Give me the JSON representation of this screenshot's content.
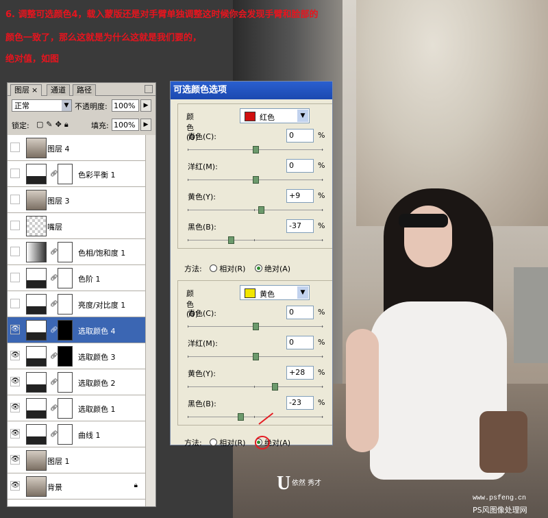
{
  "header": {
    "line1": "6. 调整可选颜色4，载入蒙版还是对手臂单独调整这时候你会发现手臂和脸部的",
    "line2": "颜色一致了，那么这就是为什么这就是我们要的，",
    "line3": "绝对值，如图"
  },
  "layers_panel": {
    "tabs": [
      {
        "label": "图层"
      },
      {
        "label": "通道"
      },
      {
        "label": "路径"
      }
    ],
    "tab_close": "×",
    "blend_mode": "正常",
    "opacity_label": "不透明度:",
    "opacity_value": "100%",
    "lock_label": "锁定:",
    "fill_label": "填充:",
    "fill_value": "100%",
    "layers": [
      {
        "name": "图层 4",
        "type": "photo",
        "visible": false
      },
      {
        "name": "色彩平衡 1",
        "type": "adjustment",
        "visible": false
      },
      {
        "name": "图层 3",
        "type": "photo",
        "visible": false
      },
      {
        "name": "嘴层",
        "type": "transparent",
        "visible": false
      },
      {
        "name": "色相/饱和度 1",
        "type": "adjustment",
        "visible": false
      },
      {
        "name": "色阶 1",
        "type": "adjustment",
        "visible": false
      },
      {
        "name": "亮度/对比度 1",
        "type": "adjustment",
        "visible": false
      },
      {
        "name": "选取颜色 4",
        "type": "adjustment",
        "visible": true,
        "selected": true,
        "mask": "black"
      },
      {
        "name": "选取颜色 3",
        "type": "adjustment",
        "visible": true,
        "mask": "black"
      },
      {
        "name": "选取颜色 2",
        "type": "adjustment",
        "visible": true
      },
      {
        "name": "选取颜色 1",
        "type": "adjustment",
        "visible": true
      },
      {
        "name": "曲线 1",
        "type": "adjustment",
        "visible": true
      },
      {
        "name": "图层 1",
        "type": "photo",
        "visible": true
      },
      {
        "name": "背景",
        "type": "photo",
        "visible": true,
        "locked": true
      }
    ]
  },
  "dialog": {
    "title": "可选颜色选项",
    "color_label": "颜色(O):",
    "percent_sign": "%",
    "method_label": "方法:",
    "relative_label": "相对(R)",
    "absolute_label": "绝对(A)",
    "group1": {
      "color": "红色",
      "swatch": "#d01010",
      "cyan_label": "青色(C):",
      "cyan": "0",
      "cyan_pos": 0.5,
      "magenta_label": "洋红(M):",
      "magenta": "0",
      "magenta_pos": 0.5,
      "yellow_label": "黄色(Y):",
      "yellow": "+9",
      "yellow_pos": 0.54,
      "black_label": "黑色(B):",
      "black": "-37",
      "black_pos": 0.32,
      "method": "absolute"
    },
    "group2": {
      "color": "黄色",
      "swatch": "#f2e600",
      "cyan_label": "青色(C):",
      "cyan": "0",
      "cyan_pos": 0.5,
      "magenta_label": "洋红(M):",
      "magenta": "0",
      "magenta_pos": 0.5,
      "yellow_label": "黄色(Y):",
      "yellow": "+28",
      "yellow_pos": 0.64,
      "black_label": "黑色(B):",
      "black": "-23",
      "black_pos": 0.39,
      "method": "absolute"
    }
  },
  "logo": {
    "letter": "U",
    "text": "依然 秀才"
  },
  "watermark": {
    "url": "www.psfeng.cn",
    "site": "PS风图像处理网"
  },
  "colors": {
    "title_red": "#e8141e",
    "selection_blue": "#3b66b3"
  }
}
